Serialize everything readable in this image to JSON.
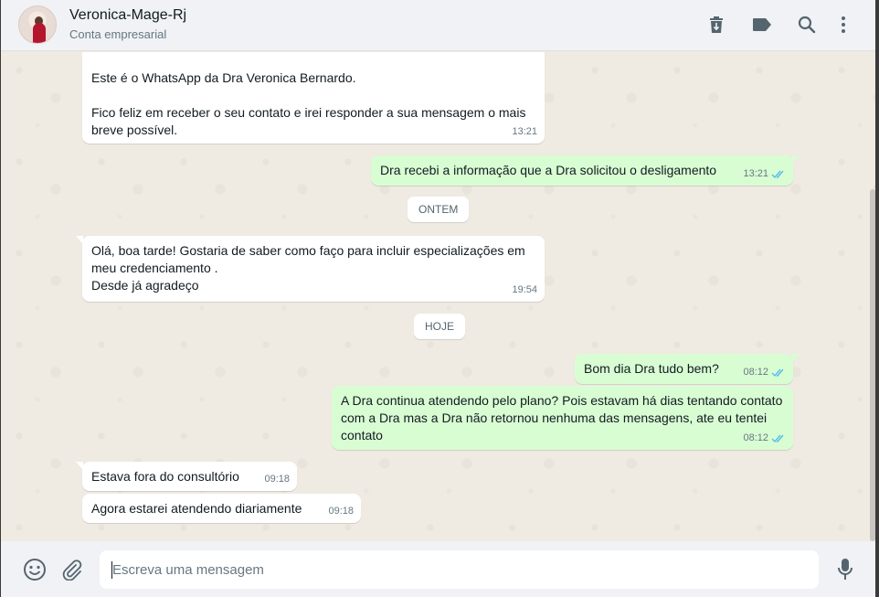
{
  "header": {
    "contact_name": "Veronica-Mage-Rj",
    "contact_subtitle": "Conta empresarial",
    "icons": [
      "delete-icon",
      "label-icon",
      "search-icon",
      "menu-icon"
    ]
  },
  "messages": [
    {
      "direction": "in",
      "text": "Este é o WhatsApp da Dra Veronica Bernardo.\n\nFico feliz em receber o seu contato e irei responder a sua mensagem o mais breve possível.",
      "time": "13:21"
    },
    {
      "direction": "out",
      "text": "Dra recebi a informação que a Dra solicitou o desligamento",
      "time": "13:21"
    },
    {
      "direction": "in",
      "text": "Olá, boa tarde! Gostaria de saber como faço para incluir especializações em meu credenciamento .\nDesde já agradeço",
      "time": "19:54"
    },
    {
      "direction": "out",
      "text": "Bom dia Dra tudo bem?",
      "time": "08:12"
    },
    {
      "direction": "out",
      "text": "A Dra continua atendendo pelo plano? Pois estavam há dias tentando contato com a Dra mas a Dra não retornou nenhuma das mensagens, ate eu tentei contato",
      "time": "08:12"
    },
    {
      "direction": "in",
      "text": "Estava fora do consultório",
      "time": "09:18"
    },
    {
      "direction": "in",
      "text": "Agora estarei atendendo diariamente",
      "time": "09:18"
    }
  ],
  "date_chips": {
    "yesterday": "ONTEM",
    "today": "HOJE"
  },
  "composer": {
    "placeholder": "Escreva uma mensagem",
    "icons": [
      "emoji-icon",
      "attach-icon",
      "microphone-icon"
    ]
  },
  "colors": {
    "outgoing_bubble": "#d9fdd3",
    "incoming_bubble": "#ffffff",
    "chat_background": "#efeae2",
    "read_tick": "#53bdeb"
  }
}
